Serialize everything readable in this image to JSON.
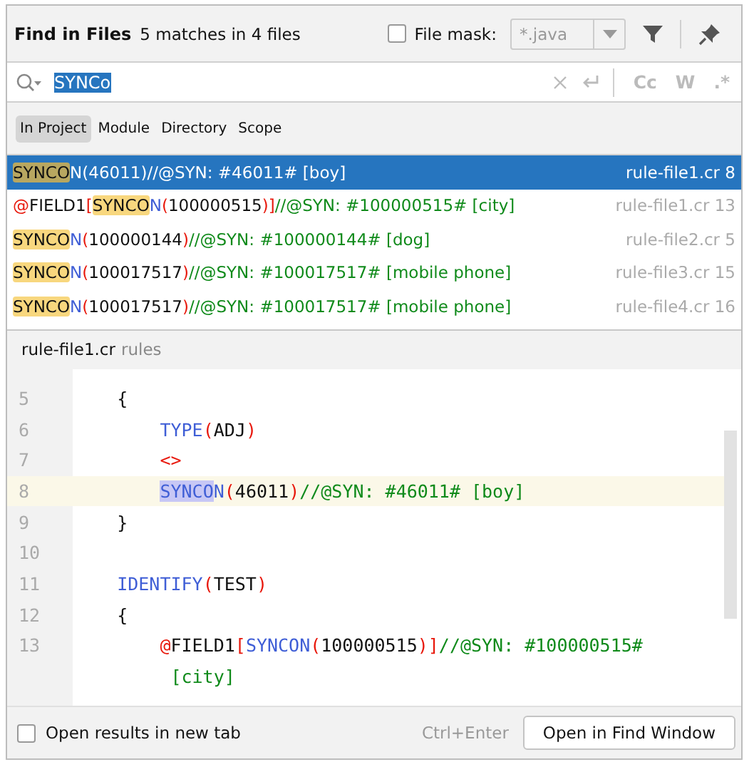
{
  "header": {
    "title": "Find in Files",
    "summary": "5 matches in 4 files",
    "file_mask": {
      "label": "File mask:",
      "checked": false,
      "value": "*.java",
      "disabled": true
    }
  },
  "search": {
    "value": "SYNCo",
    "options": [
      "Cc",
      "W",
      ".*"
    ]
  },
  "scopes": [
    {
      "label": "In Project",
      "selected": true
    },
    {
      "label": "Module",
      "selected": false
    },
    {
      "label": "Directory",
      "selected": false
    },
    {
      "label": "Scope",
      "selected": false
    }
  ],
  "results": [
    {
      "selected": true,
      "location": "rule-file1.cr 8",
      "tokens": [
        {
          "kind": "match",
          "text": "SYNCO"
        },
        {
          "kind": "keyword",
          "text": "N"
        },
        {
          "kind": "paren",
          "text": "("
        },
        {
          "kind": "plain",
          "text": "46011"
        },
        {
          "kind": "paren",
          "text": ")"
        },
        {
          "kind": "comment",
          "text": "//@SYN: #46011# [boy]"
        }
      ]
    },
    {
      "selected": false,
      "location": "rule-file1.cr 13",
      "tokens": [
        {
          "kind": "paren",
          "text": "@"
        },
        {
          "kind": "plain",
          "text": "FIELD1"
        },
        {
          "kind": "paren",
          "text": "["
        },
        {
          "kind": "match",
          "text": "SYNCO"
        },
        {
          "kind": "keyword",
          "text": "N"
        },
        {
          "kind": "paren",
          "text": "("
        },
        {
          "kind": "plain",
          "text": "100000515"
        },
        {
          "kind": "paren",
          "text": ")]"
        },
        {
          "kind": "comment",
          "text": "//@SYN: #100000515# [city]"
        }
      ]
    },
    {
      "selected": false,
      "location": "rule-file2.cr 5",
      "tokens": [
        {
          "kind": "match",
          "text": "SYNCO"
        },
        {
          "kind": "keyword",
          "text": "N"
        },
        {
          "kind": "paren",
          "text": "("
        },
        {
          "kind": "plain",
          "text": "100000144"
        },
        {
          "kind": "paren",
          "text": ")"
        },
        {
          "kind": "comment",
          "text": "//@SYN: #100000144# [dog]"
        }
      ]
    },
    {
      "selected": false,
      "location": "rule-file3.cr 15",
      "tokens": [
        {
          "kind": "match",
          "text": "SYNCO"
        },
        {
          "kind": "keyword",
          "text": "N"
        },
        {
          "kind": "paren",
          "text": "("
        },
        {
          "kind": "plain",
          "text": "100017517"
        },
        {
          "kind": "paren",
          "text": ")"
        },
        {
          "kind": "comment",
          "text": "//@SYN: #100017517# [mobile phone]"
        }
      ]
    },
    {
      "selected": false,
      "location": "rule-file4.cr 16",
      "tokens": [
        {
          "kind": "match",
          "text": "SYNCO"
        },
        {
          "kind": "keyword",
          "text": "N"
        },
        {
          "kind": "paren",
          "text": "("
        },
        {
          "kind": "plain",
          "text": "100017517"
        },
        {
          "kind": "paren",
          "text": ")"
        },
        {
          "kind": "comment",
          "text": "//@SYN: #100017517# [mobile phone]"
        }
      ]
    }
  ],
  "preview": {
    "file": "rule-file1.cr",
    "folder": "rules",
    "lines": [
      {
        "number": "5",
        "current": false,
        "tokens": [
          {
            "kind": "plain",
            "text": "    {"
          }
        ]
      },
      {
        "number": "6",
        "current": false,
        "tokens": [
          {
            "kind": "keyword",
            "text": "        TYPE"
          },
          {
            "kind": "paren",
            "text": "("
          },
          {
            "kind": "plain",
            "text": "ADJ"
          },
          {
            "kind": "paren",
            "text": ")"
          }
        ]
      },
      {
        "number": "7",
        "current": false,
        "tokens": [
          {
            "kind": "paren",
            "text": "        <>"
          }
        ]
      },
      {
        "number": "8",
        "current": true,
        "tokens": [
          {
            "kind": "match",
            "text": "        SYNCO"
          },
          {
            "kind": "keyword",
            "text": "N"
          },
          {
            "kind": "paren",
            "text": "("
          },
          {
            "kind": "plain",
            "text": "46011"
          },
          {
            "kind": "paren",
            "text": ")"
          },
          {
            "kind": "comment",
            "text": "//@SYN: #46011# [boy]"
          }
        ]
      },
      {
        "number": "9",
        "current": false,
        "tokens": [
          {
            "kind": "plain",
            "text": "    }"
          }
        ]
      },
      {
        "number": "10",
        "current": false
      },
      {
        "number": "11",
        "current": false,
        "tokens": [
          {
            "kind": "keyword",
            "text": "    IDENTIFY"
          },
          {
            "kind": "paren",
            "text": "("
          },
          {
            "kind": "plain",
            "text": "TEST"
          },
          {
            "kind": "paren",
            "text": ")"
          }
        ]
      },
      {
        "number": "12",
        "current": false,
        "tokens": [
          {
            "kind": "plain",
            "text": "    {"
          }
        ]
      },
      {
        "number": "13",
        "current": false,
        "tokens": [
          {
            "kind": "paren",
            "text": "        @"
          },
          {
            "kind": "plain",
            "text": "FIELD1"
          },
          {
            "kind": "paren",
            "text": "["
          },
          {
            "kind": "keyword",
            "text": "SYNCON"
          },
          {
            "kind": "paren",
            "text": "("
          },
          {
            "kind": "plain",
            "text": "100000515"
          },
          {
            "kind": "paren",
            "text": ")]"
          },
          {
            "kind": "comment",
            "text": "//@SYN: #100000515#"
          }
        ],
        "wrapped": [
          {
            "kind": "comment",
            "text": "         [city]"
          }
        ]
      }
    ]
  },
  "footer": {
    "new_tab": {
      "label": "Open results in new tab",
      "checked": false
    },
    "shortcut": "Ctrl+Enter",
    "button": "Open in Find Window"
  }
}
